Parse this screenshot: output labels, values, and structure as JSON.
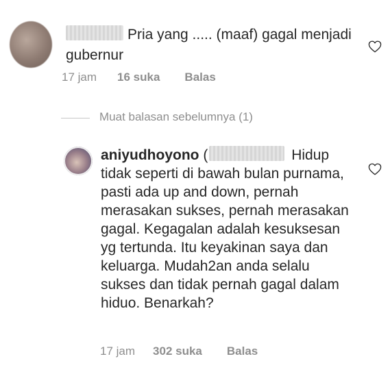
{
  "comment_1": {
    "text_suffix": "Pria yang ..... (maaf) gagal menjadi gubernur",
    "time": "17 jam",
    "likes": "16 suka",
    "reply": "Balas",
    "like_icon": "heart-outline-icon"
  },
  "view_previous": {
    "label": "Muat balasan sebelumnya (1)"
  },
  "comment_2": {
    "username": "aniyudhoyono",
    "mention_open": "(",
    "text": "Hidup tidak seperti di bawah bulan purnama, pasti ada up and down, pernah merasakan sukses, pernah merasakan gagal. Kegagalan adalah kesuksesan yg tertunda. Itu keyakinan saya dan keluarga. Mudah2an anda selalu sukses dan tidak pernah gagal dalam hiduo. Benarkah?",
    "time": "17 jam",
    "likes": "302 suka",
    "reply": "Balas",
    "like_icon": "heart-outline-icon"
  },
  "colors": {
    "text": "#262626",
    "secondary": "#8e8e8e",
    "divider": "#c7c7c7"
  }
}
